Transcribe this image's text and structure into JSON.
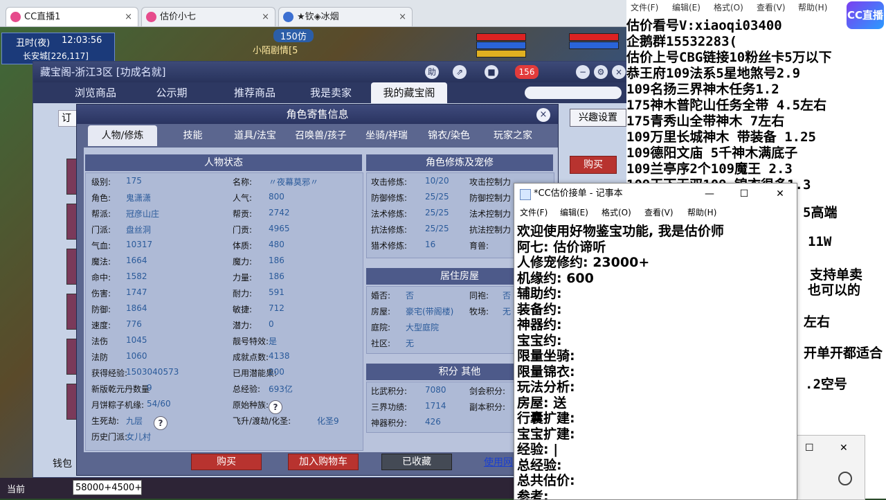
{
  "browser": {
    "tabs": [
      {
        "label": "CC直播1",
        "active": true
      },
      {
        "label": "估价小七",
        "active": false
      },
      {
        "label": "★钦◈冰烟",
        "active": false
      }
    ],
    "close_glyph": "×"
  },
  "game_hud": {
    "time_of_day": "丑时(夜)",
    "clock": "12:03:56",
    "location": "长安城[226,117]",
    "overhead_name": "小陌剧情[5",
    "overhead_title": "150仿"
  },
  "cbg": {
    "window_title": "藏宝阁-浙江3区 [功成名就]",
    "title_buttons": [
      "助",
      "⇗",
      "■",
      "156",
      "−",
      "⚙",
      "×"
    ],
    "nav": [
      {
        "label": "浏览商品",
        "active": false
      },
      {
        "label": "公示期",
        "active": false
      },
      {
        "label": "推荐商品",
        "active": false
      },
      {
        "label": "我是卖家",
        "active": false
      },
      {
        "label": "我的藏宝阁",
        "active": true
      }
    ],
    "order_label": "订",
    "interest_button": "兴趣设置",
    "buy_side_button": "购买",
    "wallet_label": "钱包"
  },
  "dialog": {
    "title": "角色寄售信息",
    "close": "×",
    "tabs": [
      {
        "label": "人物/修炼",
        "active": true
      },
      {
        "label": "技能",
        "active": false
      },
      {
        "label": "道具/法宝",
        "active": false
      },
      {
        "label": "召唤兽/孩子",
        "active": false
      },
      {
        "label": "坐骑/祥瑞",
        "active": false
      },
      {
        "label": "锦衣/染色",
        "active": false
      },
      {
        "label": "玩家之家",
        "active": false
      }
    ],
    "section_status": "人物状态",
    "section_cultivation": "角色修炼及宠修",
    "section_house": "居住房屋",
    "section_points": "积分 其他",
    "status_left": [
      {
        "label": "级别:",
        "value": "175"
      },
      {
        "label": "角色:",
        "value": "鬼潇潇"
      },
      {
        "label": "帮派:",
        "value": "冠彦山庄"
      },
      {
        "label": "门派:",
        "value": "盘丝洞"
      },
      {
        "label": "气血:",
        "value": "10317"
      },
      {
        "label": "魔法:",
        "value": "1664"
      },
      {
        "label": "命中:",
        "value": "1582"
      },
      {
        "label": "伤害:",
        "value": "1747"
      },
      {
        "label": "防御:",
        "value": "1864"
      },
      {
        "label": "速度:",
        "value": "776"
      },
      {
        "label": "法伤",
        "value": "1045"
      },
      {
        "label": "法防",
        "value": "1060"
      },
      {
        "label": "获得经验:",
        "value": "1503040573"
      },
      {
        "label": "新版乾元丹数量",
        "value": "9"
      },
      {
        "label": "月饼粽子机缘:",
        "value": "54/60"
      },
      {
        "label": "生死劫:",
        "value": "九层"
      },
      {
        "label": "历史门派:",
        "value": "女儿村"
      }
    ],
    "status_right": [
      {
        "label": "名称:",
        "value": "〃夜幕莫邪〃"
      },
      {
        "label": "人气:",
        "value": "800"
      },
      {
        "label": "帮贡:",
        "value": "2742"
      },
      {
        "label": "门贡:",
        "value": "4965"
      },
      {
        "label": "体质:",
        "value": "480"
      },
      {
        "label": "魔力:",
        "value": "186"
      },
      {
        "label": "力量:",
        "value": "186"
      },
      {
        "label": "耐力:",
        "value": "591"
      },
      {
        "label": "敏捷:",
        "value": "712"
      },
      {
        "label": "潜力:",
        "value": "0"
      },
      {
        "label": "靓号特效:",
        "value": "是"
      },
      {
        "label": "成就点数:",
        "value": "4138"
      },
      {
        "label": "已用潜能果:",
        "value": "200"
      },
      {
        "label": "总经验:",
        "value": "693亿"
      },
      {
        "label": "原始种族:",
        "value": "人"
      },
      {
        "label": "飞升/渡劫/化圣:",
        "value": "化圣9"
      }
    ],
    "help_mark": "?",
    "cultivation": [
      {
        "label": "攻击修炼:",
        "value": "10/20",
        "label2": "攻击控制力"
      },
      {
        "label": "防御修炼:",
        "value": "25/25",
        "label2": "防御控制力"
      },
      {
        "label": "法术修炼:",
        "value": "25/25",
        "label2": "法术控制力"
      },
      {
        "label": "抗法修炼:",
        "value": "25/25",
        "label2": "抗法控制力"
      },
      {
        "label": "猎术修炼:",
        "value": "16",
        "label2": "育兽:"
      }
    ],
    "house": [
      {
        "label": "婚否:",
        "value": "否",
        "label2": "同袍:",
        "value2": "否"
      },
      {
        "label": "房屋:",
        "value": "豪宅(带阁楼)",
        "label2": "牧场:",
        "value2": "无"
      },
      {
        "label": "庭院:",
        "value": "大型庭院"
      },
      {
        "label": "社区:",
        "value": "无"
      }
    ],
    "points": [
      {
        "label": "比武积分:",
        "value": "7080",
        "label2": "剑会积分:"
      },
      {
        "label": "三界功绩:",
        "value": "1714",
        "label2": "副本积分:"
      },
      {
        "label": "神器积分:",
        "value": "426"
      }
    ],
    "buttons": {
      "buy": "购买",
      "cart": "加入购物车",
      "fav": "已收藏",
      "use_link": "使用网"
    }
  },
  "chat": {
    "channel": "当前",
    "input": "58000+4500+"
  },
  "overlay": {
    "menu": [
      "文件(F)",
      "编辑(E)",
      "格式(O)",
      "查看(V)",
      "帮助(H)"
    ],
    "logo": "CC直播",
    "lines": [
      "估价看号V:xiaoqi03400",
      "企鹅群15532283(",
      "估价上号CBG链接10粉丝卡5万以下",
      "恭王府109法系5星地煞号2.9",
      "109名扬三界神木任务1.2",
      "175神木普陀山任务全带 4.5左右",
      "175青秀山全带神木  7左右",
      "109万里长城神木 带装备  1.25",
      "109德阳文庙 5千神木满底子",
      "109兰亭序2个109魔王 2.3",
      "109天下无双109  锦衣很多1.3",
      "5高端",
      "11W",
      "支持单卖",
      "也可以的",
      "左右",
      "开单开都适合",
      ".2空号"
    ]
  },
  "notepad": {
    "title": "*CC估价接单 - 记事本",
    "menu": [
      "文件(F)",
      "编辑(E)",
      "格式(O)",
      "查看(V)",
      "帮助(H)"
    ],
    "controls": [
      "—",
      "☐",
      "✕"
    ],
    "lines": [
      "欢迎使用好物鉴宝功能, 我是估价师",
      "阿七: 估价谛听",
      "人修宠修约: 23000+",
      "机缘约: 600",
      "辅助约:",
      "装备约:",
      "神器约:",
      "宝宝约:",
      "限量坐骑:",
      "限量锦衣:",
      "玩法分析:",
      "房屋: 送",
      "行囊扩建:",
      "宝宝扩建:",
      "经验: |",
      "总经验:",
      "总共估价:",
      "参考:"
    ]
  },
  "win2": {
    "controls": [
      "☐",
      "✕"
    ]
  }
}
